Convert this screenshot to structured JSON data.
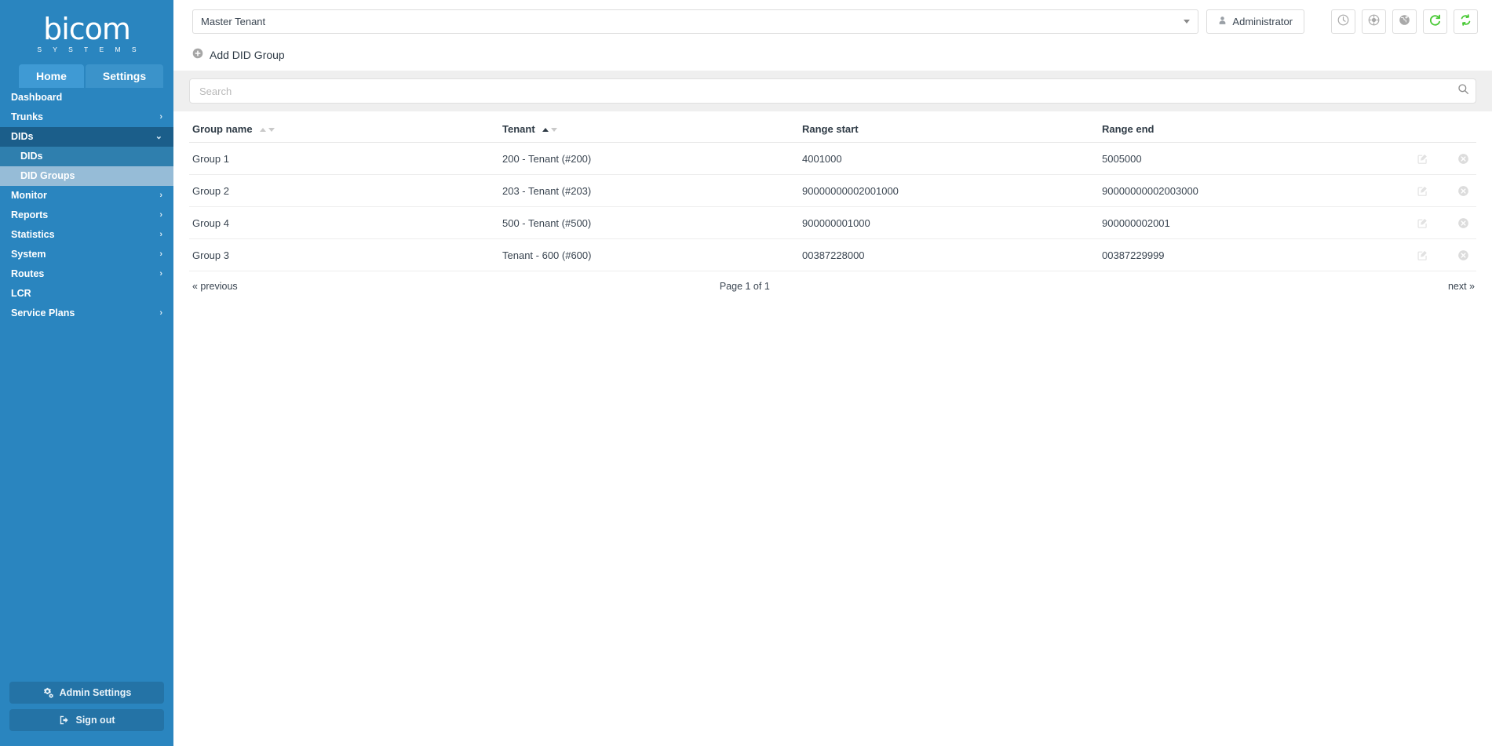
{
  "brand": {
    "name": "bicom",
    "subtitle": "S Y S T E M S"
  },
  "tabs": [
    {
      "label": "Home",
      "active": true
    },
    {
      "label": "Settings",
      "active": false
    }
  ],
  "sidebar": {
    "items": [
      {
        "label": "Dashboard",
        "expandable": false,
        "state": "normal"
      },
      {
        "label": "Trunks",
        "expandable": true,
        "state": "normal"
      },
      {
        "label": "DIDs",
        "expandable": true,
        "state": "open"
      },
      {
        "label": "Monitor",
        "expandable": true,
        "state": "normal"
      },
      {
        "label": "Reports",
        "expandable": true,
        "state": "normal"
      },
      {
        "label": "Statistics",
        "expandable": true,
        "state": "normal"
      },
      {
        "label": "System",
        "expandable": true,
        "state": "normal"
      },
      {
        "label": "Routes",
        "expandable": true,
        "state": "normal"
      },
      {
        "label": "LCR",
        "expandable": false,
        "state": "normal"
      },
      {
        "label": "Service Plans",
        "expandable": true,
        "state": "normal"
      }
    ],
    "subitems": [
      {
        "label": "DIDs",
        "active": false
      },
      {
        "label": "DID Groups",
        "active": true
      }
    ],
    "admin_settings_label": "Admin Settings",
    "sign_out_label": "Sign out"
  },
  "topbar": {
    "tenant_value": "Master Tenant",
    "admin_label": "Administrator",
    "icons": [
      {
        "name": "clock-icon",
        "color": "#a9a9a9"
      },
      {
        "name": "lifebuoy-icon",
        "color": "#a9a9a9"
      },
      {
        "name": "globe-icon",
        "color": "#a9a9a9"
      },
      {
        "name": "refresh-icon",
        "color": "#46c832"
      },
      {
        "name": "sync-icon",
        "color": "#46c832"
      }
    ]
  },
  "actions": {
    "add_label": "Add DID Group"
  },
  "search": {
    "placeholder": "Search",
    "value": ""
  },
  "table": {
    "columns": [
      {
        "label": "Group name",
        "sortable": true,
        "sort": "none"
      },
      {
        "label": "Tenant",
        "sortable": true,
        "sort": "asc"
      },
      {
        "label": "Range start",
        "sortable": false,
        "sort": "none"
      },
      {
        "label": "Range end",
        "sortable": false,
        "sort": "none"
      },
      {
        "label": "",
        "sortable": false,
        "sort": "none"
      }
    ],
    "rows": [
      {
        "group_name": "Group 1",
        "tenant": "200 - Tenant (#200)",
        "range_start": "4001000",
        "range_end": "5005000"
      },
      {
        "group_name": "Group 2",
        "tenant": "203 - Tenant (#203)",
        "range_start": "90000000002001000",
        "range_end": "90000000002003000"
      },
      {
        "group_name": "Group 4",
        "tenant": "500 - Tenant (#500)",
        "range_start": "900000001000",
        "range_end": "900000002001"
      },
      {
        "group_name": "Group 3",
        "tenant": "Tenant - 600 (#600)",
        "range_start": "00387228000",
        "range_end": "00387229999"
      }
    ],
    "row_actions": [
      {
        "name": "edit-icon",
        "title": "Edit"
      },
      {
        "name": "delete-icon",
        "title": "Delete"
      }
    ]
  },
  "pagination": {
    "previous_label": "« previous",
    "page_label": "Page 1 of 1",
    "next_label": "next »"
  },
  "colors": {
    "sidebar_bg": "#2a85bf",
    "sidebar_open": "#1b5e8a",
    "sidebar_sub": "#2f7fae",
    "sidebar_sub_active": "#96bcd7",
    "search_band": "#efefef",
    "accent_green": "#46c832",
    "text": "#2f3b46"
  }
}
